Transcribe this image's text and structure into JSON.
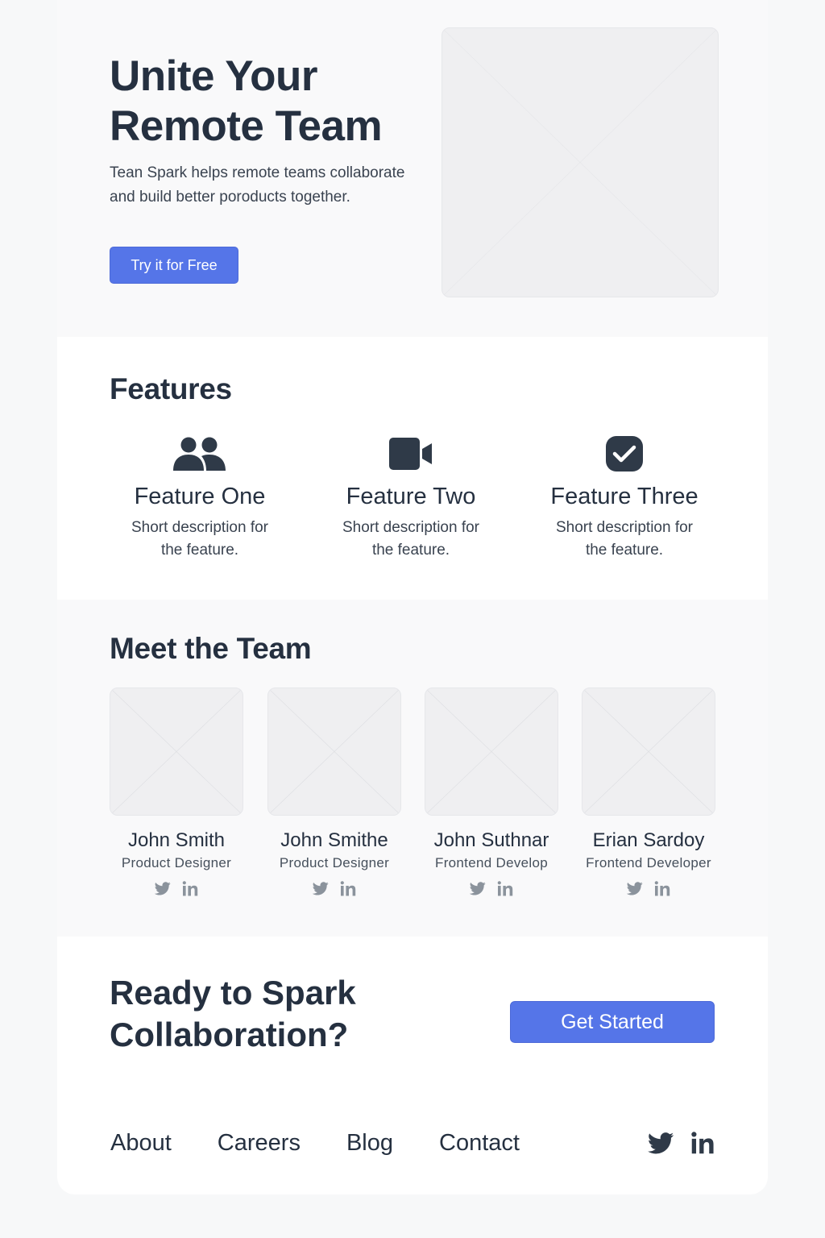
{
  "hero": {
    "title_line1": "Unite Your",
    "title_line2": "Remote Team",
    "subtitle": "Tean Spark helps remote teams collaborate and build better poroducts together.",
    "cta_label": "Try it for Free"
  },
  "features": {
    "title": "Features",
    "items": [
      {
        "icon": "users-icon",
        "title": "Feature One",
        "description": "Short description for the feature."
      },
      {
        "icon": "video-camera-icon",
        "title": "Feature Two",
        "description": "Short description for the feature."
      },
      {
        "icon": "checkbox-icon",
        "title": "Feature Three",
        "description": "Short description for the feature."
      }
    ]
  },
  "team": {
    "title": "Meet the Team",
    "members": [
      {
        "name": "John Smith",
        "role": "Product Designer"
      },
      {
        "name": "John Smithe",
        "role": "Product Designer"
      },
      {
        "name": "John Suthnar",
        "role": "Frontend Develop"
      },
      {
        "name": "Erian Sardoy",
        "role": "Frontend Developer"
      }
    ],
    "social_icons": [
      "twitter-icon",
      "linkedin-icon"
    ]
  },
  "cta": {
    "title_line1": "Ready to Spark",
    "title_line2": "Collaboration?",
    "button_label": "Get Started"
  },
  "footer": {
    "links": [
      "About",
      "Careers",
      "Blog",
      "Contact"
    ],
    "social_icons": [
      "twitter-icon",
      "linkedin-icon"
    ]
  },
  "colors": {
    "accent": "#5575e8",
    "heading": "#253040",
    "icon": "#2f3a48",
    "muted_icon": "#8b939c"
  }
}
